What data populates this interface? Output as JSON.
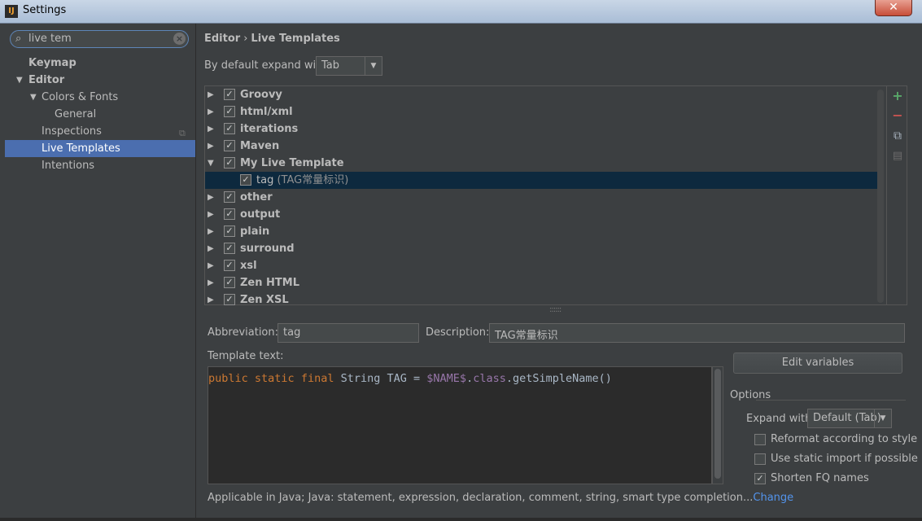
{
  "window": {
    "title": "Settings",
    "close_label": "✕"
  },
  "search": {
    "value": "live tem"
  },
  "sidebar": {
    "items": [
      {
        "label": "Keymap"
      },
      {
        "label": "Editor"
      },
      {
        "label": "Colors & Fonts"
      },
      {
        "label": "General"
      },
      {
        "label": "Inspections"
      },
      {
        "label": "Live Templates"
      },
      {
        "label": "Intentions"
      }
    ]
  },
  "breadcrumb": {
    "parent": "Editor",
    "separator": "›",
    "current": "Live Templates"
  },
  "expand": {
    "label": "By default expand with",
    "value": "Tab"
  },
  "templates": {
    "groups": [
      {
        "name": "Groovy"
      },
      {
        "name": "html/xml"
      },
      {
        "name": "iterations"
      },
      {
        "name": "Maven"
      },
      {
        "name": "My Live Template"
      },
      {
        "name": "other"
      },
      {
        "name": "output"
      },
      {
        "name": "plain"
      },
      {
        "name": "surround"
      },
      {
        "name": "xsl"
      },
      {
        "name": "Zen HTML"
      },
      {
        "name": "Zen XSL"
      }
    ],
    "child": {
      "name": "tag",
      "description": "(TAG常量标识)"
    }
  },
  "detail": {
    "abbreviation_label": "Abbreviation:",
    "abbreviation_value": "tag",
    "description_label": "Description:",
    "description_value": "TAG常量标识",
    "template_text_label": "Template text:",
    "code": {
      "kw1": "public",
      "kw2": "static",
      "kw3": "final",
      "type": "String TAG = ",
      "var": "$NAME$",
      "dot": ".",
      "kw4": "class",
      "rest": ".getSimpleName()"
    },
    "edit_variables": "Edit variables",
    "options_title": "Options",
    "expand_with_label": "Expand with",
    "expand_with_value": "Default (Tab)",
    "reformat_label": "Reformat according to style",
    "static_import_label": "Use static import if possible",
    "shorten_label": "Shorten FQ names",
    "applicable_text": "Applicable in Java; Java: statement, expression, declaration, comment, string, smart type completion...",
    "change_link": "Change"
  },
  "colors": {
    "accent": "#4b6eaf",
    "selected_row": "#0d293e",
    "add": "#59a869",
    "remove": "#c75450",
    "link": "#5394ec"
  }
}
